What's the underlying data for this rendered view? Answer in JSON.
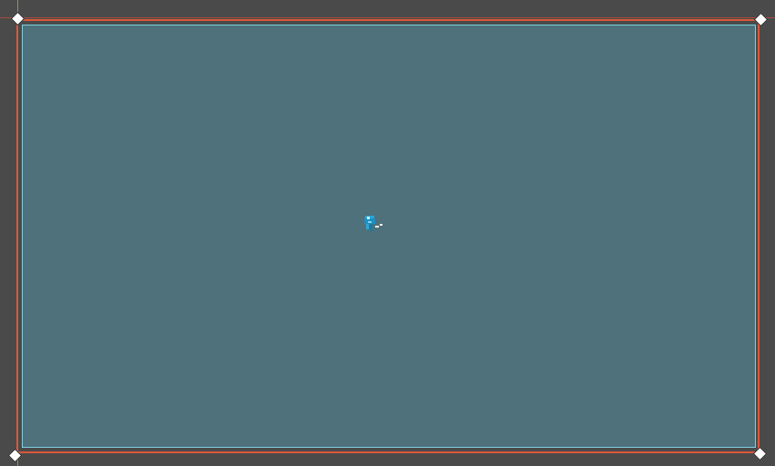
{
  "scene": {
    "background_color": "#4a4a4a",
    "room_color": "#4e717b",
    "room_border_color": "#7fd0df",
    "camera_frame_color": "#d9583a",
    "x_axis_color": "#b84a3a",
    "y_axis_color": "#8ea23c"
  },
  "player": {
    "icon": "player-sprite-icon",
    "color": "#2aa6d6"
  }
}
